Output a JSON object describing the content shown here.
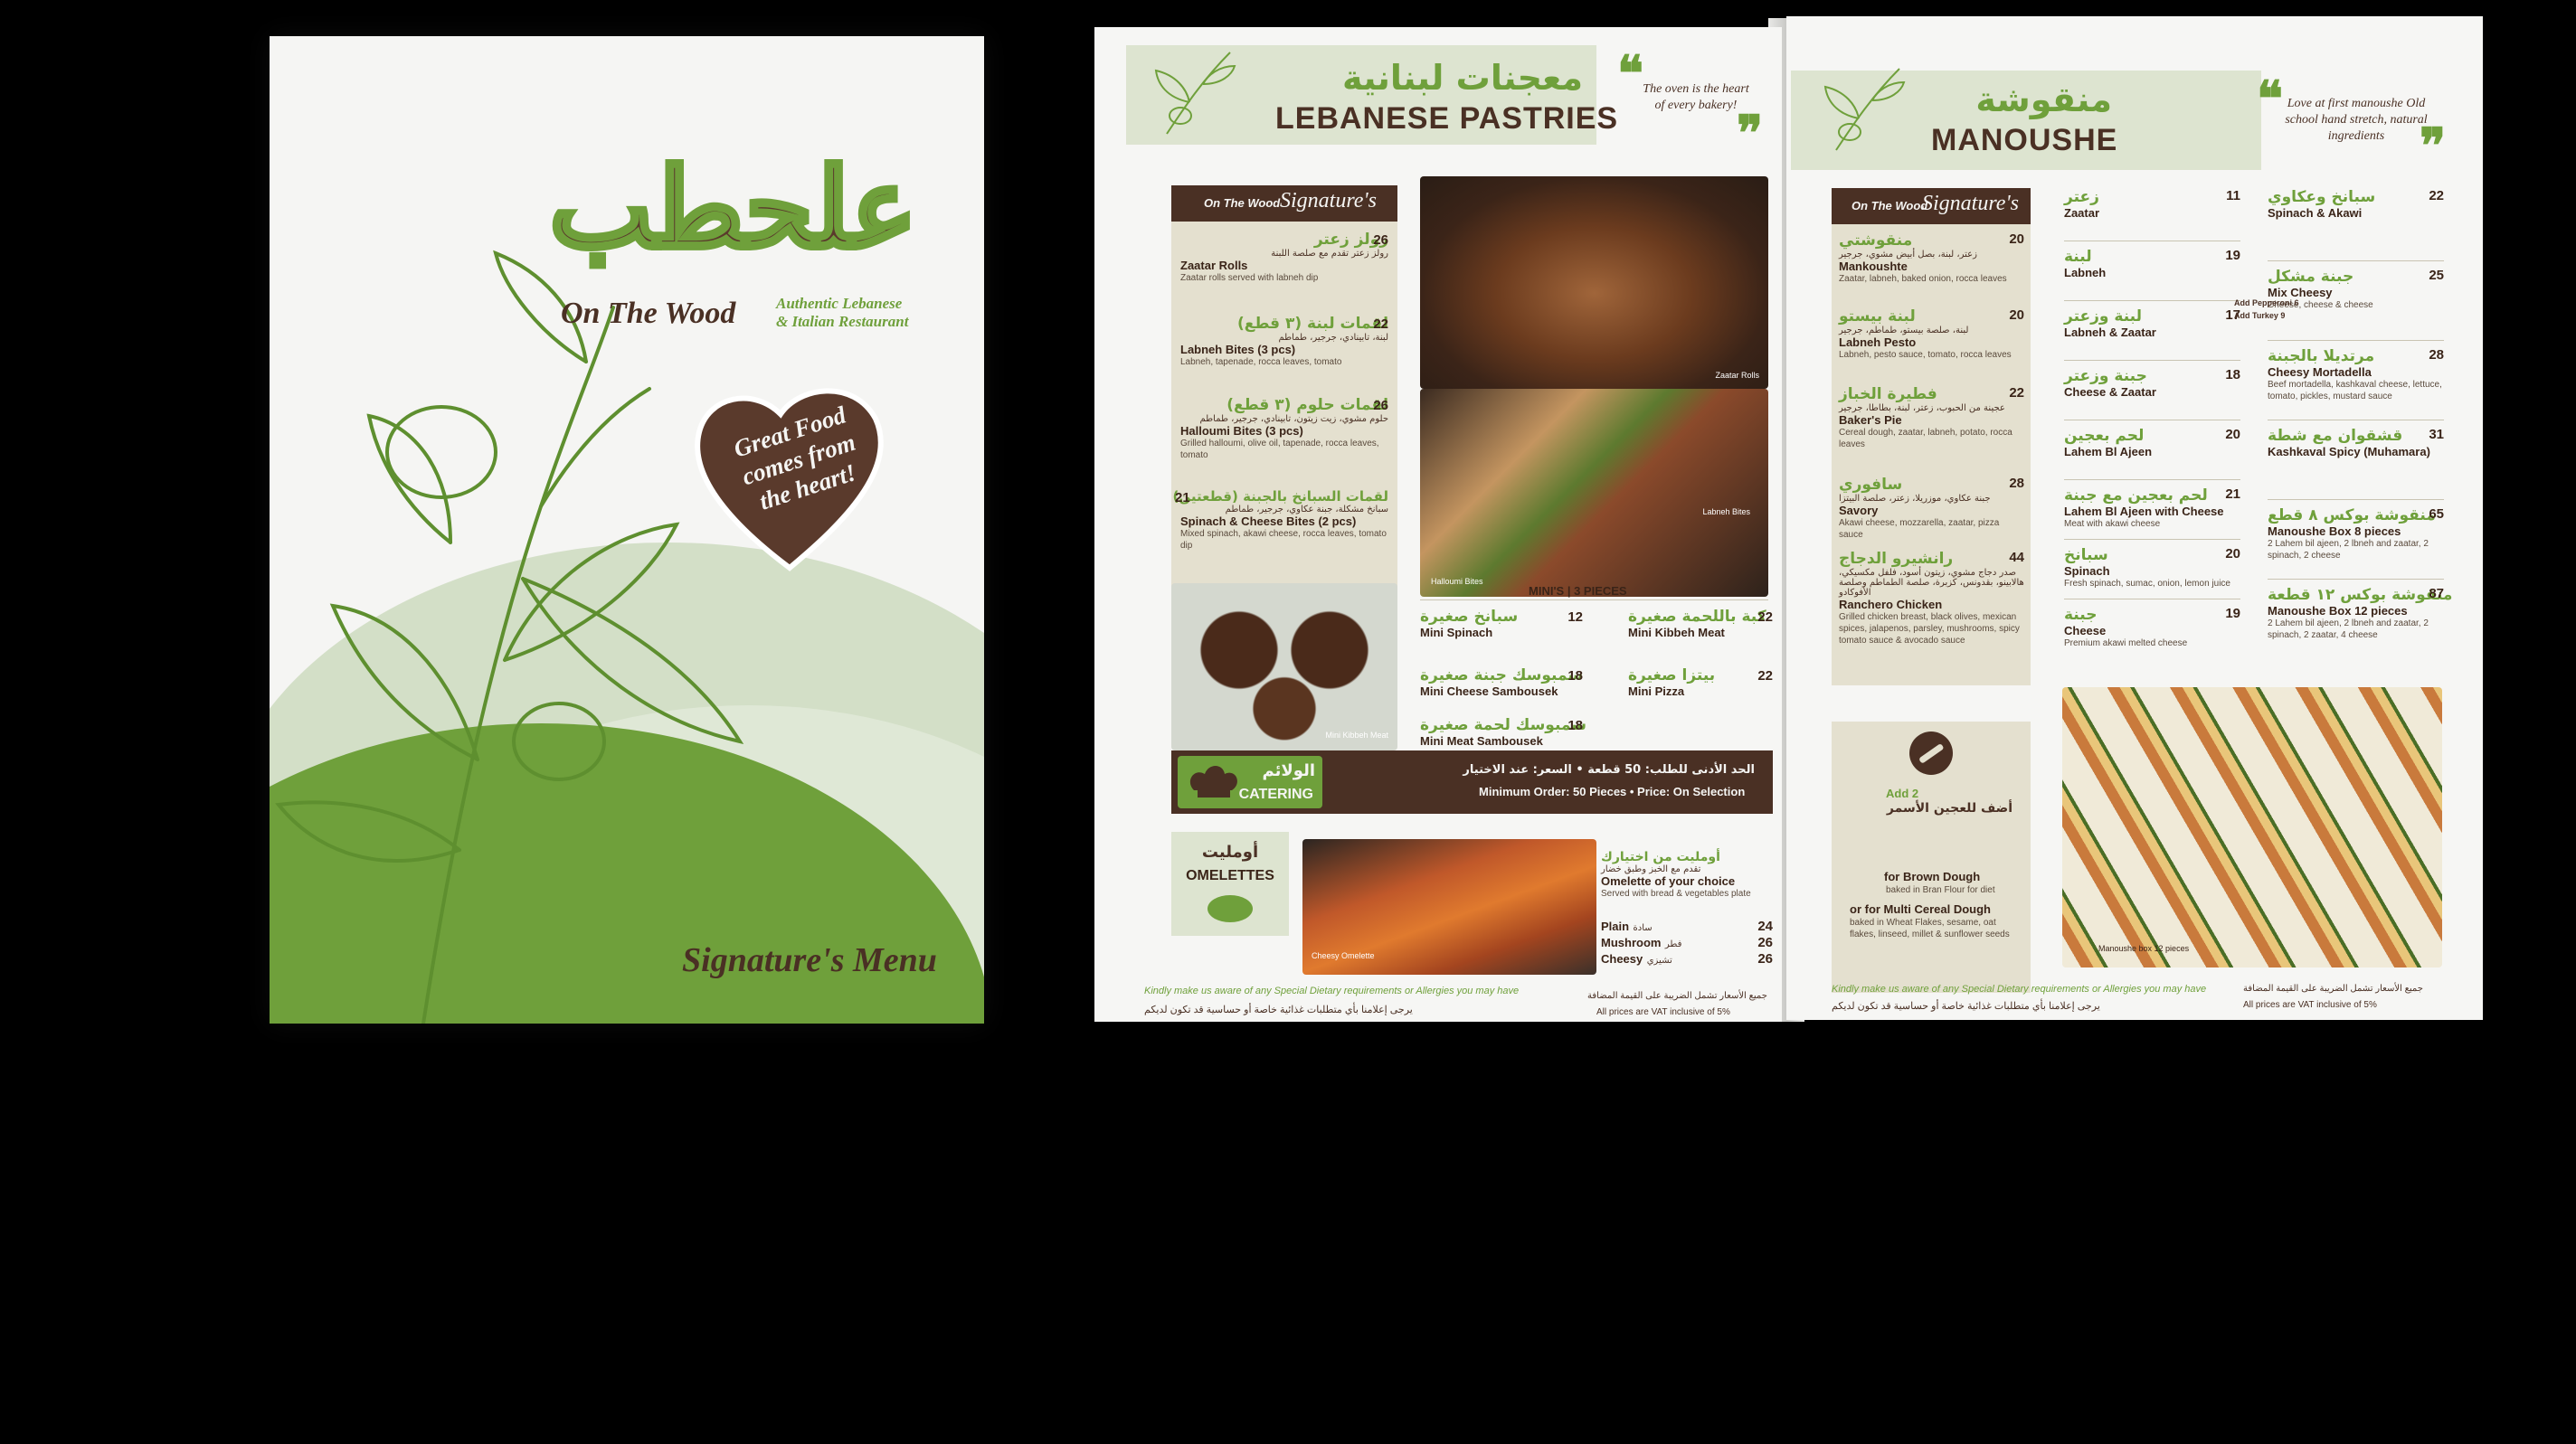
{
  "cover": {
    "logo_ar": "علحطب",
    "logo_en": "On The Wood",
    "tagline_l1": "Authentic Lebanese",
    "tagline_l2": "& Italian Restaurant",
    "heart_text": "Great Food comes from the heart!",
    "menu_title": "Signature's Menu"
  },
  "pastries": {
    "header_ar": "معجنات لبنانية",
    "header_en": "LEBANESE PASTRIES",
    "quote": "The oven is the heart of every bakery!",
    "sig_label": "On The Wood",
    "sig_title": "Signature's",
    "items": [
      {
        "ar": "رولز زعتر",
        "ar_desc": "رولز زعتر تقدم مع صلصة اللبنة",
        "en": "Zaatar Rolls",
        "desc": "Zaatar rolls served with labneh dip",
        "price": "26"
      },
      {
        "ar": "لقمات لبنة (٣ قطع)",
        "ar_desc": "لبنة، تابينادي، جرجير، طماطم",
        "en": "Labneh Bites (3 pcs)",
        "desc": "Labneh, tapenade, rocca leaves, tomato",
        "price": "22"
      },
      {
        "ar": "لقمات حلوم (٣ قطع)",
        "ar_desc": "حلوم مشوي، زيت زيتون، تابينادي، جرجير، طماطم",
        "en": "Halloumi Bites (3 pcs)",
        "desc": "Grilled halloumi, olive oil, tapenade, rocca leaves, tomato",
        "price": "26"
      },
      {
        "ar": "لقمات السبانخ بالجبنة (قطعتين)",
        "ar_desc": "سبانخ مشكلة، جبنة عكاوي، جرجير، طماطم",
        "en": "Spinach & Cheese Bites (2 pcs)",
        "desc": "Mixed spinach, akawi cheese, rocca leaves, tomato dip",
        "price": "21"
      }
    ],
    "photo_labels": [
      "Zaatar Rolls",
      "Labneh Bites",
      "Halloumi Bites",
      "Mini Kibbeh Meat"
    ],
    "minis_title": "MINI'S | 3 PIECES",
    "minis": [
      {
        "ar": "سبانخ صغيرة",
        "en": "Mini Spinach",
        "price": "12"
      },
      {
        "ar": "كبة باللحمة صغيرة",
        "en": "Mini Kibbeh Meat",
        "price": "22"
      },
      {
        "ar": "سمبوسك جبنة صغيرة",
        "en": "Mini Cheese Sambousek",
        "price": "18"
      },
      {
        "ar": "بيتزا صغيرة",
        "en": "Mini Pizza",
        "price": "22"
      },
      {
        "ar": "سمبوسك لحمة صغيرة",
        "en": "Mini Meat Sambousek",
        "price": "18"
      }
    ],
    "catering_ar": "الولائم",
    "catering_en": "CATERING",
    "catering_text_ar": "الحد الأدنى للطلب: 50 قطعة • السعر: عند الاختيار",
    "catering_text_en": "Minimum Order: 50 Pieces • Price: On Selection",
    "omelette_ar": "أومليت",
    "omelette_en": "OMELETTES",
    "omelette_item_ar": "أومليت من اختيارك",
    "omelette_item_ar_desc": "تقدم مع الخبز وطبق خضار",
    "omelette_item_en": "Omelette of your choice",
    "omelette_item_desc": "Served with bread & vegetables plate",
    "omelette_photo_label": "Cheesy Omelette",
    "omelette_opts": [
      {
        "en": "Plain",
        "ar": "سادة",
        "price": "24"
      },
      {
        "en": "Mushroom",
        "ar": "فطر",
        "price": "26"
      },
      {
        "en": "Cheesy",
        "ar": "تشيزي",
        "price": "26"
      }
    ],
    "foot_en": "Kindly make us aware of any Special Dietary requirements or Allergies you may have",
    "foot_ar": "يرجى إعلامنا بأي متطلبات غذائية خاصة أو حساسية قد تكون لديكم",
    "vat_ar": "جميع الأسعار تشمل الضريبة على القيمة المضافة",
    "vat_en": "All prices are VAT inclusive of 5%"
  },
  "manoushe": {
    "header_ar": "منقوشة",
    "header_en": "MANOUSHE",
    "quote": "Love at first manoushe Old school hand stretch, natural ingredients",
    "sig_label": "On The Wood",
    "sig_title": "Signature's",
    "sig_items": [
      {
        "ar": "منقوشتي",
        "ar_desc": "زعتر، لبنة، بصل أبيض مشوي، جرجير",
        "en": "Mankoushte",
        "desc": "Zaatar, labneh, baked onion, rocca leaves",
        "price": "20"
      },
      {
        "ar": "لبنة بيستو",
        "ar_desc": "لبنة، صلصة بيستو، طماطم، جرجير",
        "en": "Labneh Pesto",
        "desc": "Labneh, pesto sauce, tomato, rocca leaves",
        "price": "20"
      },
      {
        "ar": "فطيرة الخباز",
        "ar_desc": "عجينة من الحبوب، زعتر، لبنة، بطاطا، جرجير",
        "en": "Baker's Pie",
        "desc": "Cereal dough, zaatar, labneh, potato, rocca leaves",
        "price": "22"
      },
      {
        "ar": "سافوري",
        "ar_desc": "جبنة عكاوي، موزريلا، زعتر، صلصة البيتزا",
        "en": "Savory",
        "desc": "Akawi cheese, mozzarella, zaatar, pizza sauce",
        "price": "28"
      },
      {
        "ar": "رانشيرو الدجاج",
        "ar_desc": "صدر دجاج مشوي، زيتون أسود، فلفل مكسيكي، هالابينو، بقدونس، كزبرة، صلصة الطماطم وصلصة الأفوكادو",
        "en": "Ranchero Chicken",
        "desc": "Grilled chicken breast, black olives, mexican spices, jalapenos, parsley, mushrooms, spicy tomato sauce & avocado sauce",
        "price": "44"
      }
    ],
    "col2": [
      {
        "ar": "زعتر",
        "en": "Zaatar",
        "desc": "",
        "price": "11"
      },
      {
        "ar": "لبنة",
        "en": "Labneh",
        "desc": "",
        "price": "19"
      },
      {
        "ar": "لبنة وزعتر",
        "en": "Labneh & Zaatar",
        "desc": "",
        "price": "17"
      },
      {
        "ar": "جبنة وزعتر",
        "en": "Cheese & Zaatar",
        "desc": "",
        "price": "18"
      },
      {
        "ar": "لحم بعجين",
        "en": "Lahem Bl Ajeen",
        "desc": "",
        "price": "20"
      },
      {
        "ar": "لحم بعجين مع جبنة",
        "en": "Lahem Bl Ajeen with Cheese",
        "desc": "Meat with akawi cheese",
        "price": "21"
      },
      {
        "ar": "سبانخ",
        "en": "Spinach",
        "desc": "Fresh spinach, sumac, onion, lemon juice",
        "price": "20"
      },
      {
        "ar": "جبنة",
        "en": "Cheese",
        "desc": "Premium akawi melted cheese",
        "price": "19"
      }
    ],
    "col3": [
      {
        "ar": "سبانخ وعكاوي",
        "en": "Spinach & Akawi",
        "desc": "",
        "price": "22"
      },
      {
        "ar": "جبنة مشكل",
        "en": "Mix Cheesy",
        "desc": "Cheese, cheese & cheese",
        "price": "25"
      },
      {
        "ar": "مرتديلا بالجبنة",
        "en": "Cheesy Mortadella",
        "desc": "Beef mortadella, kashkaval cheese, lettuce, tomato, pickles, mustard sauce",
        "price": "28"
      },
      {
        "ar": "قشقوان مع شطة",
        "en": "Kashkaval Spicy (Muhamara)",
        "desc": "",
        "price": "31"
      },
      {
        "ar": "منقوشة بوكس ٨ قطع",
        "en": "Manoushe Box 8 pieces",
        "desc": "2 Lahem bil ajeen, 2 lbneh and zaatar, 2 spinach, 2 cheese",
        "price": "65"
      },
      {
        "ar": "منقوشة بوكس ١٢ قطعة",
        "en": "Manoushe Box 12 pieces",
        "desc": "2 Lahem bil ajeen, 2 lbneh and zaatar, 2 spinach, 2 zaatar, 4 cheese",
        "price": "87"
      }
    ],
    "mix_add1": "Add Pepperoni 6",
    "mix_add2": "Add Turkey 9",
    "dough_add": "Add 2",
    "dough_ar": "أضف للعجين الأسمر",
    "dough_l1": "for Brown Dough",
    "dough_l1_desc": "baked in Bran Flour for diet",
    "dough_l2": "or for Multi Cereal Dough",
    "dough_l2_desc": "baked in Wheat Flakes, sesame, oat flakes, linseed, millet & sunflower seeds",
    "box_photo_label": "Manoushe box 12 pieces",
    "foot_en": "Kindly make us aware of any Special Dietary requirements or Allergies you may have",
    "foot_ar": "يرجى إعلامنا بأي متطلبات غذائية خاصة أو حساسية قد تكون لديكم",
    "vat_ar": "جميع الأسعار تشمل الضريبة على القيمة المضافة",
    "vat_en": "All prices are VAT inclusive of 5%"
  },
  "colors": {
    "brown": "#4a3024",
    "green": "#6fa03b",
    "paper": "#f6f6f4",
    "panel": "#e4e0cf"
  }
}
